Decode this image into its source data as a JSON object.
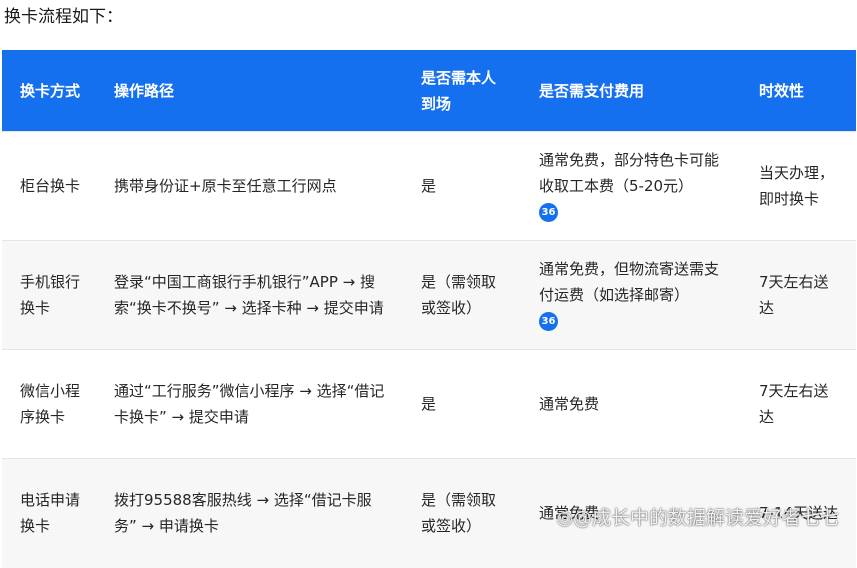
{
  "intro": "换卡流程如下：",
  "headers": [
    "换卡方式",
    "操作路径",
    "是否需本人到场",
    "是否需支付费用",
    "时效性"
  ],
  "rows": [
    {
      "method": "柜台换卡",
      "path": "携带身份证+原卡至任意工行网点",
      "in_person": "是",
      "fee": "通常免费，部分特色卡可能收取工本费（5-20元）",
      "fee_cite": "36",
      "timing": "当天办理，即时换卡"
    },
    {
      "method": "手机银行换卡",
      "path": "登录“中国工商银行手机银行”APP → 搜索“换卡不换号” → 选择卡种 → 提交申请",
      "in_person": "是（需领取或签收）",
      "fee": "通常免费，但物流寄送需支付运费（如选择邮寄）",
      "fee_cite": "36",
      "timing": "7天左右送达"
    },
    {
      "method": "微信小程序换卡",
      "path": "通过“工行服务”微信小程序 → 选择“借记卡换卡” → 提交申请",
      "in_person": "是",
      "fee": "通常免费",
      "fee_cite": "",
      "timing": "7天左右送达"
    },
    {
      "method": "电话申请换卡",
      "path": "拨打95588客服热线 → 选择“借记卡服务” → 申请换卡",
      "in_person": "是（需领取或签收）",
      "fee": "通常免费",
      "fee_cite": "",
      "timing": "7-14天送达"
    }
  ],
  "watermark": "◎@成长中的数据解读爱好者七七"
}
